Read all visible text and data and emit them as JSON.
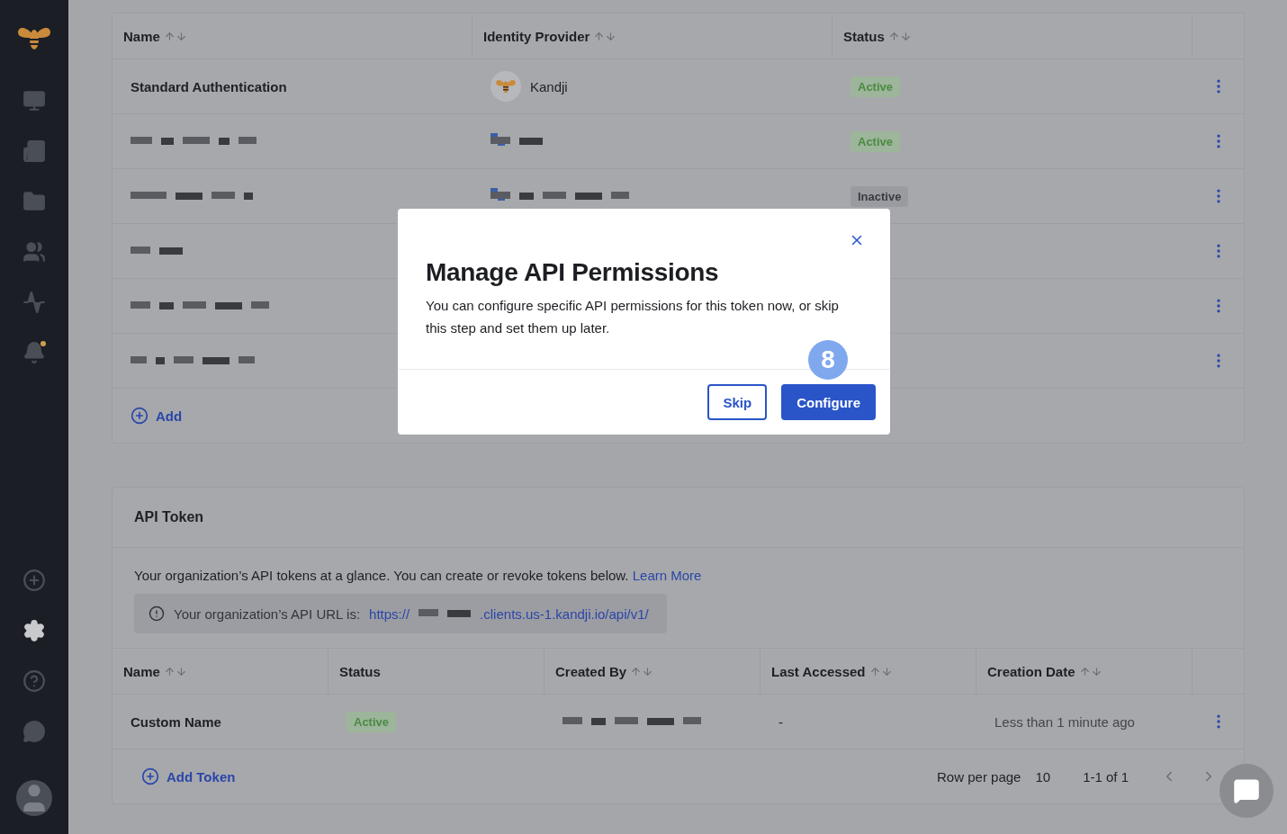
{
  "sidebar": {
    "top_items": [
      {
        "kind": "devices",
        "selected": false,
        "notification": false
      },
      {
        "kind": "library",
        "selected": false,
        "notification": false
      },
      {
        "kind": "folder",
        "selected": false,
        "notification": false
      },
      {
        "kind": "users",
        "selected": false,
        "notification": false
      },
      {
        "kind": "activity",
        "selected": false,
        "notification": false
      },
      {
        "kind": "alerts",
        "selected": false,
        "notification": true
      }
    ],
    "bottom_items": [
      {
        "kind": "add",
        "selected": false,
        "notification": false
      },
      {
        "kind": "settings",
        "selected": true,
        "notification": false
      },
      {
        "kind": "help",
        "selected": false,
        "notification": false
      },
      {
        "kind": "chat",
        "selected": false,
        "notification": false
      }
    ]
  },
  "auth_table": {
    "columns": [
      {
        "label": "Name",
        "sortable": true
      },
      {
        "label": "Identity Provider",
        "sortable": true
      },
      {
        "label": "Status",
        "sortable": true
      }
    ],
    "rows": [
      {
        "name": "Standard Authentication",
        "provider": "Kandji",
        "status": "Active",
        "active": true
      },
      {
        "status": "Active",
        "active": true
      },
      {
        "status": "Inactive",
        "active": false
      },
      {},
      {},
      {}
    ],
    "add_label": "Add"
  },
  "api_token": {
    "title": "API Token",
    "intro": "Your organization’s API tokens at a glance. You can create or revoke tokens below.",
    "learn_more": "Learn More",
    "url_label": "Your organization’s API URL is:",
    "url_prefix": "https://",
    "url_suffix": ".clients.us-1.kandji.io/api/v1/",
    "columns": [
      {
        "label": "Name",
        "sortable": true
      },
      {
        "label": "Status",
        "sortable": false
      },
      {
        "label": "Created By",
        "sortable": true
      },
      {
        "label": "Last Accessed",
        "sortable": true
      },
      {
        "label": "Creation Date",
        "sortable": true
      }
    ],
    "rows": [
      {
        "name": "Custom Name",
        "status": "Active",
        "active": true,
        "last_accessed": "-",
        "creation_date": "Less than 1 minute ago"
      }
    ],
    "add_label": "Add Token",
    "rows_per_page_label": "Row per page",
    "rows_per_page": "10",
    "range": "1-1 of 1"
  },
  "modal": {
    "title": "Manage API Permissions",
    "body": "You can configure specific API permissions for this token now, or skip this step and set them up later.",
    "step": "8",
    "buttons": [
      {
        "label": "Skip",
        "primary": false
      },
      {
        "label": "Configure",
        "primary": true
      }
    ]
  }
}
